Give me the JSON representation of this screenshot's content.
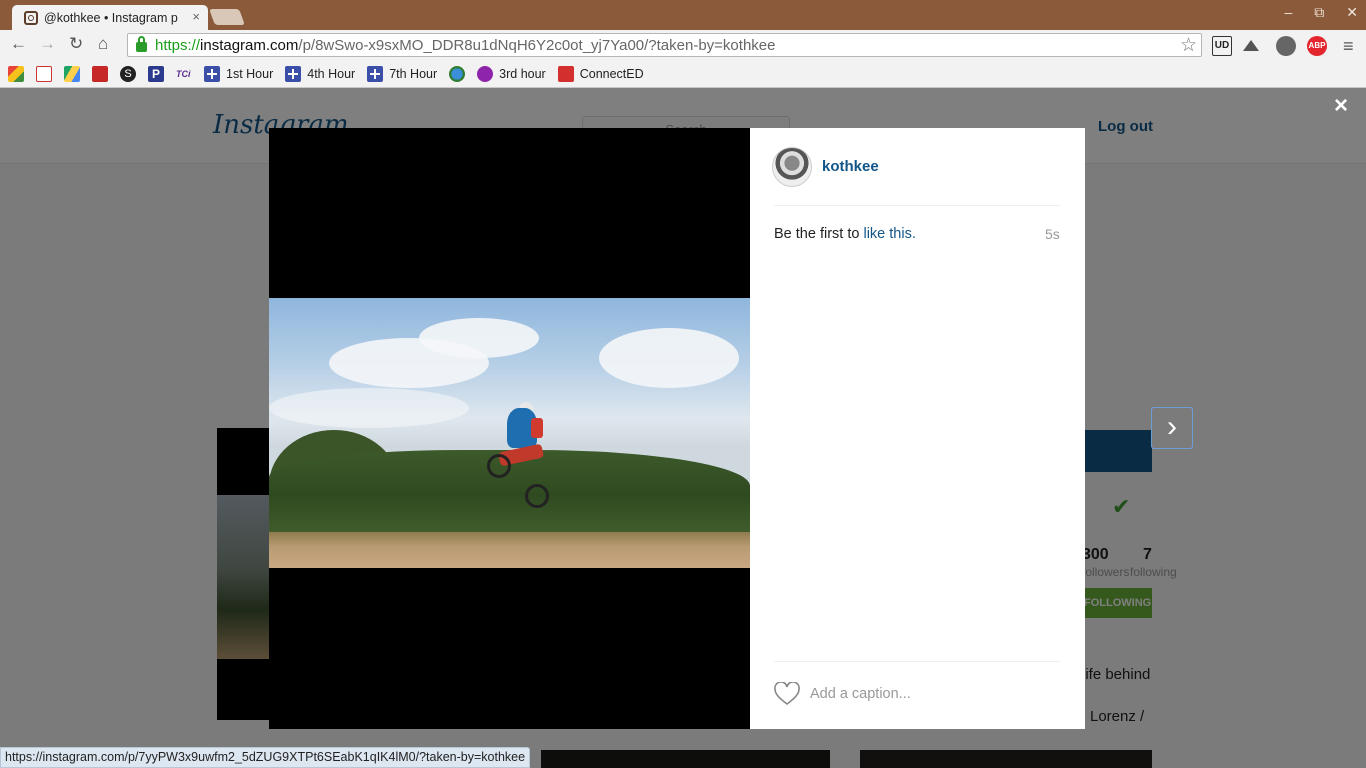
{
  "browser": {
    "tab_title": "@kothkee • Instagram p",
    "tab_close": "×",
    "window_controls": [
      "–",
      "⧉",
      "✕"
    ],
    "url": {
      "scheme": "https://",
      "host": "instagram.com",
      "path": "/p/8wSwo-x9sxMO_DDR8u1dNqH6Y2c0ot_yj7Ya00/?taken-by=kothkee"
    },
    "extensions": [
      "UD",
      "ABP"
    ],
    "status_url": "https://instagram.com/p/7yyPW3x9uwfm2_5dZUG9XTPt6SEabK1qIK4lM0/?taken-by=kothkee"
  },
  "bookmarks": [
    {
      "label": "1st Hour"
    },
    {
      "label": "4th Hour"
    },
    {
      "label": "7th Hour"
    },
    {
      "label": "3rd hour"
    },
    {
      "label": "ConnectED"
    }
  ],
  "bookmark_icon_labels": {
    "tci": "TCi",
    "s": "S",
    "p": "P"
  },
  "instagram": {
    "logo": "Instagram",
    "search_placeholder": "Search",
    "logout": "Log out",
    "followers_count": "300",
    "followers_label": "followers",
    "following_count": "7",
    "following_label": "following",
    "following_button": "FOLLOWING",
    "bio_line1": "life behind",
    "bio_line2": "Lorenz /"
  },
  "modal": {
    "close": "×",
    "next": "›",
    "username": "kothkee",
    "likes_prefix": "Be the first to ",
    "likes_link": "like this.",
    "timestamp": "5s",
    "caption_placeholder": "Add a caption..."
  },
  "colors": {
    "link_blue": "#125688",
    "tab_bar": "#8a5a3a",
    "follow_green": "#6bb33b"
  }
}
